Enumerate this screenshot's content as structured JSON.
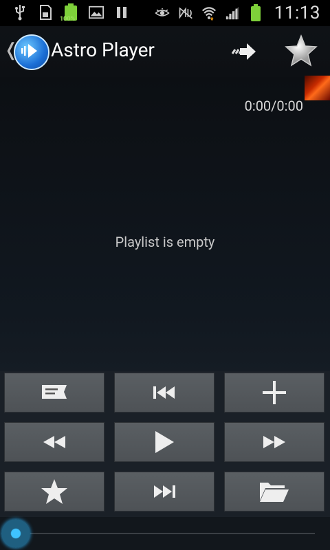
{
  "status_bar": {
    "battery_percent": "100%",
    "clock": "11:13",
    "icons_left": [
      "usb-icon",
      "sd-card-icon",
      "battery-full-icon",
      "image-icon",
      "pause-icon"
    ],
    "icons_right": [
      "eye-icon",
      "nfc-mute-icon",
      "wifi-icon",
      "signal-icon",
      "battery-icon"
    ]
  },
  "action_bar": {
    "title": "Astro Player",
    "back_glyph": "❬"
  },
  "player": {
    "time": "0:00/0:00",
    "empty_message": "Playlist is empty"
  },
  "controls": {
    "buttons": [
      {
        "name": "lyrics",
        "icon": "comment-icon"
      },
      {
        "name": "previous",
        "icon": "skip-previous-icon"
      },
      {
        "name": "add",
        "icon": "plus-icon"
      },
      {
        "name": "rewind",
        "icon": "rewind-icon"
      },
      {
        "name": "play",
        "icon": "play-icon"
      },
      {
        "name": "fast-forward",
        "icon": "fast-forward-icon"
      },
      {
        "name": "favorite",
        "icon": "star-icon"
      },
      {
        "name": "next",
        "icon": "skip-next-icon"
      },
      {
        "name": "open-folder",
        "icon": "folder-icon"
      }
    ]
  },
  "seek": {
    "position": 0
  }
}
